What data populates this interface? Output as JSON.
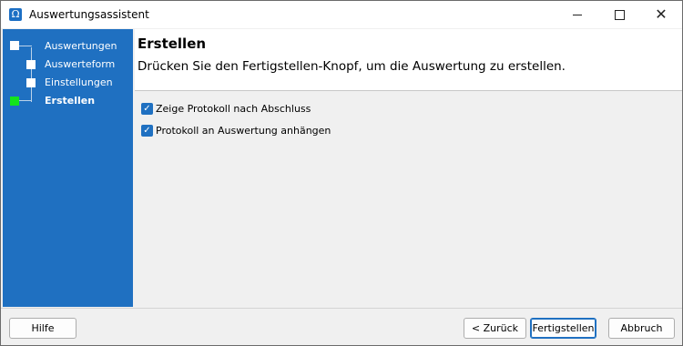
{
  "window": {
    "title": "Auswertungsassistent",
    "app_icon": "omega-icon",
    "controls": {
      "minimize": "minimize-icon",
      "maximize": "maximize-icon",
      "close": "close-icon"
    }
  },
  "steps": [
    {
      "label": "Auswertungen",
      "state": "done"
    },
    {
      "label": "Auswerteform",
      "state": "done"
    },
    {
      "label": "Einstellungen",
      "state": "done"
    },
    {
      "label": "Erstellen",
      "state": "current"
    }
  ],
  "header": {
    "title": "Erstellen",
    "description": "Drücken Sie den Fertigstellen-Knopf, um die Auswertung zu erstellen."
  },
  "options": [
    {
      "label": "Zeige Protokoll nach Abschluss",
      "checked": true
    },
    {
      "label": "Protokoll an Auswertung anhängen",
      "checked": true
    }
  ],
  "buttons": {
    "help": "Hilfe",
    "back": "< Zurück",
    "finish": "Fertigstellen",
    "cancel": "Abbruch"
  },
  "colors": {
    "sidebar": "#1f70c1",
    "current_step_marker": "#13e41c",
    "checkbox": "#1f70c1"
  }
}
